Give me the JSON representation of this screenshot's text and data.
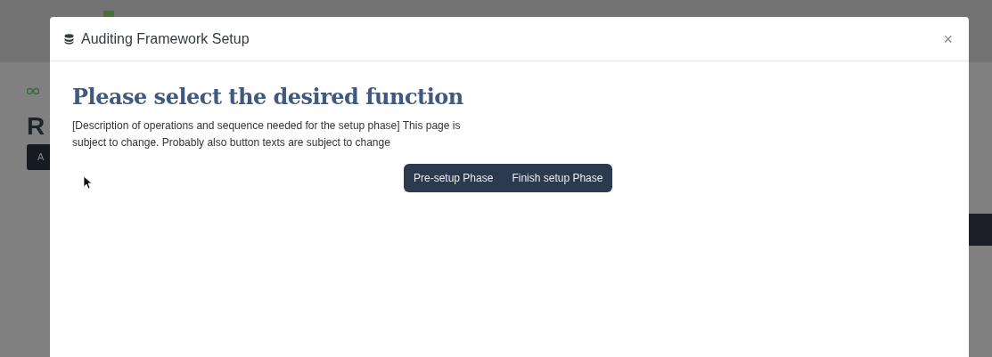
{
  "background": {
    "heading": "R",
    "button": "A"
  },
  "modal": {
    "title": "Auditing Framework Setup",
    "close": "×",
    "heading": "Please select the desired function",
    "description": "[Description of operations and sequence needed for the setup phase] This page is subject to change. Probably also button texts are subject to change",
    "buttons": [
      {
        "label": "Pre-setup Phase"
      },
      {
        "label": "Finish setup Phase"
      }
    ]
  }
}
